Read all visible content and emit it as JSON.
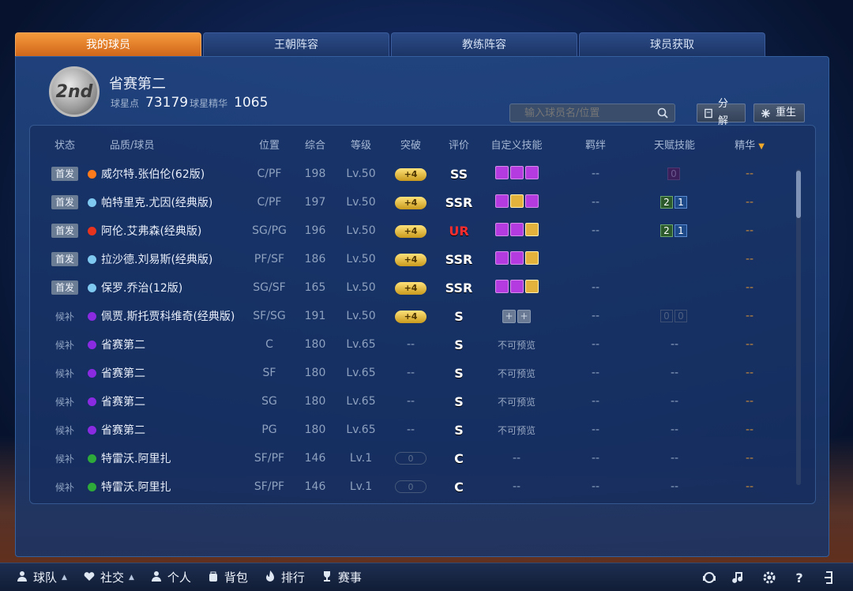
{
  "tabs": [
    {
      "label": "我的球员",
      "active": true
    },
    {
      "label": "王朝阵容",
      "active": false
    },
    {
      "label": "教练阵容",
      "active": false
    },
    {
      "label": "球员获取",
      "active": false
    }
  ],
  "profile": {
    "rank_badge": "2nd",
    "title": "省赛第二",
    "points_label": "球星点",
    "points_value": "73179",
    "essence_label": "球星精华",
    "essence_value": "1065"
  },
  "search": {
    "placeholder": "输入球员名/位置",
    "value": ""
  },
  "actions": {
    "decompose": "分解",
    "reborn": "重生"
  },
  "headers": [
    "状态",
    "品质/球员",
    "位置",
    "综合",
    "等级",
    "突破",
    "评价",
    "自定义技能",
    "羁绊",
    "天赋技能",
    "精华"
  ],
  "essence_sort_indicator": "▼",
  "players": [
    {
      "status": "首发",
      "starter": true,
      "quality_color": "#ff7a1a",
      "name": "威尔特.张伯伦(62版)",
      "position": "C/PF",
      "overall": "198",
      "level": "Lv.50",
      "break": "+4",
      "rating": "SS",
      "skills": [
        "purple",
        "purple",
        "purple"
      ],
      "bond": "--",
      "talent": [
        "0"
      ],
      "talent_style": [
        "dimp"
      ],
      "essence": "--"
    },
    {
      "status": "首发",
      "starter": true,
      "quality_color": "#7fc8f0",
      "name": "帕特里克.尤因(经典版)",
      "position": "C/PF",
      "overall": "197",
      "level": "Lv.50",
      "break": "+4",
      "rating": "SSR",
      "skills": [
        "purple",
        "gold",
        "purple"
      ],
      "bond": "--",
      "talent": [
        "2",
        "1"
      ],
      "talent_style": [
        "green",
        "blue"
      ],
      "essence": "--"
    },
    {
      "status": "首发",
      "starter": true,
      "quality_color": "#e8331f",
      "name": "阿伦.艾弗森(经典版)",
      "position": "SG/PG",
      "overall": "196",
      "level": "Lv.50",
      "break": "+4",
      "rating": "UR",
      "skills": [
        "purple",
        "purple",
        "gold"
      ],
      "bond": "--",
      "talent": [
        "2",
        "1"
      ],
      "talent_style": [
        "green",
        "blue"
      ],
      "essence": "--"
    },
    {
      "status": "首发",
      "starter": true,
      "quality_color": "#7fc8f0",
      "name": "拉沙德.刘易斯(经典版)",
      "position": "PF/SF",
      "overall": "186",
      "level": "Lv.50",
      "break": "+4",
      "rating": "SSR",
      "skills": [
        "purple",
        "purple",
        "gold"
      ],
      "bond": "",
      "talent": [],
      "talent_style": [],
      "essence": "--"
    },
    {
      "status": "首发",
      "starter": true,
      "quality_color": "#7fc8f0",
      "name": "保罗.乔治(12版)",
      "position": "SG/SF",
      "overall": "165",
      "level": "Lv.50",
      "break": "+4",
      "rating": "SSR",
      "skills": [
        "purple",
        "purple",
        "gold"
      ],
      "bond": "--",
      "talent": [],
      "talent_style": [],
      "essence": "--"
    },
    {
      "status": "候补",
      "starter": false,
      "quality_color": "#8a2be2",
      "name": "佩贾.斯托贾科维奇(经典版)",
      "position": "SF/SG",
      "overall": "191",
      "level": "Lv.50",
      "break": "+4",
      "rating": "S",
      "skills": [
        "empty",
        "empty"
      ],
      "bond": "--",
      "talent": [
        "0",
        "0"
      ],
      "talent_style": [
        "dim",
        "dim"
      ],
      "essence": "--"
    },
    {
      "status": "候补",
      "starter": false,
      "quality_color": "#8a2be2",
      "name": "省赛第二",
      "position": "C",
      "overall": "180",
      "level": "Lv.65",
      "break": "--",
      "rating": "S",
      "skills_text": "不可预览",
      "bond": "--",
      "talent_text": "--",
      "essence": "--"
    },
    {
      "status": "候补",
      "starter": false,
      "quality_color": "#8a2be2",
      "name": "省赛第二",
      "position": "SF",
      "overall": "180",
      "level": "Lv.65",
      "break": "--",
      "rating": "S",
      "skills_text": "不可预览",
      "bond": "--",
      "talent_text": "--",
      "essence": "--"
    },
    {
      "status": "候补",
      "starter": false,
      "quality_color": "#8a2be2",
      "name": "省赛第二",
      "position": "SG",
      "overall": "180",
      "level": "Lv.65",
      "break": "--",
      "rating": "S",
      "skills_text": "不可预览",
      "bond": "--",
      "talent_text": "--",
      "essence": "--"
    },
    {
      "status": "候补",
      "starter": false,
      "quality_color": "#8a2be2",
      "name": "省赛第二",
      "position": "PG",
      "overall": "180",
      "level": "Lv.65",
      "break": "--",
      "rating": "S",
      "skills_text": "不可预览",
      "bond": "--",
      "talent_text": "--",
      "essence": "--"
    },
    {
      "status": "候补",
      "starter": false,
      "quality_color": "#2eaa3a",
      "name": "特雷沃.阿里扎",
      "position": "SF/PF",
      "overall": "146",
      "level": "Lv.1",
      "break": "0",
      "break_empty": true,
      "rating": "C",
      "skills_text": "--",
      "bond": "--",
      "talent_text": "--",
      "essence": "--"
    },
    {
      "status": "候补",
      "starter": false,
      "quality_color": "#2eaa3a",
      "name": "特雷沃.阿里扎",
      "position": "SF/PF",
      "overall": "146",
      "level": "Lv.1",
      "break": "0",
      "break_empty": true,
      "rating": "C",
      "skills_text": "--",
      "bond": "--",
      "talent_text": "--",
      "essence": "--"
    }
  ],
  "bottom_nav": [
    {
      "label": "球队",
      "icon": "person-icon",
      "arrow": "▲"
    },
    {
      "label": "社交",
      "icon": "heart-icon",
      "arrow": "▲"
    },
    {
      "label": "个人",
      "icon": "person-icon",
      "arrow": ""
    },
    {
      "label": "背包",
      "icon": "bag-icon",
      "arrow": ""
    },
    {
      "label": "排行",
      "icon": "flame-icon",
      "arrow": ""
    },
    {
      "label": "赛事",
      "icon": "trophy-icon",
      "arrow": ""
    }
  ],
  "bottom_right_icons": [
    "support-icon",
    "music-icon",
    "gear-icon",
    "help-icon",
    "exit-icon"
  ]
}
